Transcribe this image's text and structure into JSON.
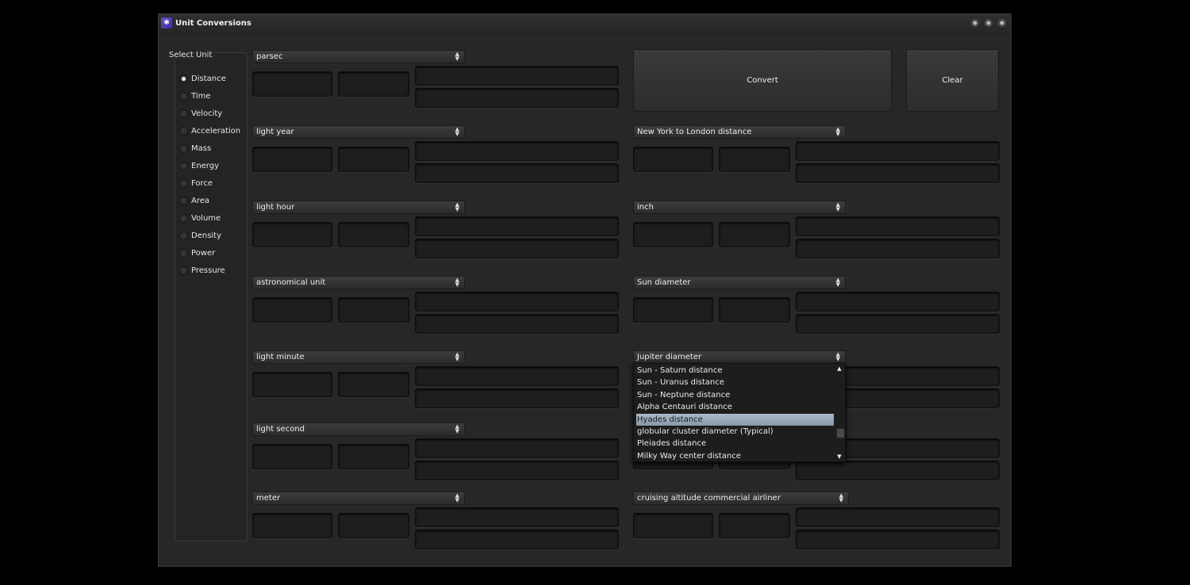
{
  "window": {
    "title": "Unit Conversions"
  },
  "unit_panel": {
    "title": "Select Unit",
    "options": [
      "Distance",
      "Time",
      "Velocity",
      "Acceleration",
      "Mass",
      "Energy",
      "Force",
      "Area",
      "Volume",
      "Density",
      "Power",
      "Pressure"
    ],
    "selected": "Distance"
  },
  "actions": {
    "convert": "Convert",
    "clear": "Clear"
  },
  "left_column": [
    "parsec",
    "light year",
    "light hour",
    "astronomical unit",
    "light minute",
    "light second",
    "meter"
  ],
  "right_column": [
    "New York to London distance",
    "inch",
    "Sun diameter",
    "Jupiter diameter",
    "",
    "cruising altitude commercial airliner"
  ],
  "dropdown": {
    "items": [
      "Sun - Saturn distance",
      "Sun - Uranus distance",
      "Sun - Neptune distance",
      "Alpha Centauri distance",
      "Hyades distance",
      "globular cluster diameter (Typical)",
      "Pleiades distance",
      "Milky Way center distance"
    ],
    "highlighted": "Hyades distance"
  }
}
